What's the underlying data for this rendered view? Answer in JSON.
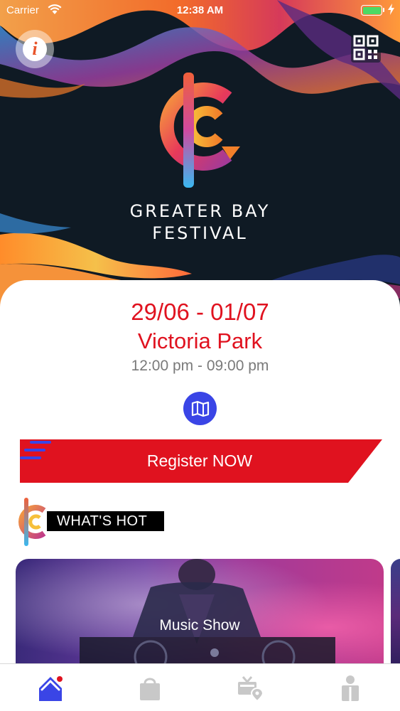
{
  "status_bar": {
    "carrier": "Carrier",
    "time": "12:38 AM"
  },
  "hero": {
    "title_line1": "GREATER BAY",
    "title_line2": "FESTIVAL"
  },
  "event": {
    "dates": "29/06 - 01/07",
    "venue": "Victoria Park",
    "hours": "12:00 pm - 09:00 pm"
  },
  "register": {
    "label": "Register NOW"
  },
  "whats_hot": {
    "label": "WHAT'S HOT",
    "featured_caption": "Music Show"
  },
  "tab_bar": {
    "items": [
      {
        "icon": "home-icon",
        "active": true
      },
      {
        "icon": "shopping-bag-icon",
        "active": false
      },
      {
        "icon": "venue-map-icon",
        "active": false
      },
      {
        "icon": "profile-icon",
        "active": false
      }
    ]
  },
  "colors": {
    "accent_red": "#e0121f",
    "accent_blue": "#3a45e6",
    "inactive_gray": "#c8c8c8",
    "hero_background": "#0f1a24"
  }
}
